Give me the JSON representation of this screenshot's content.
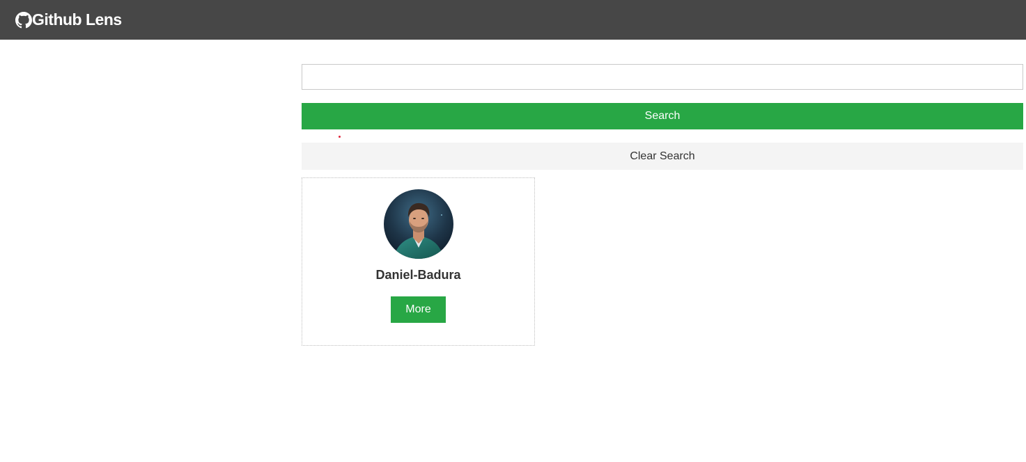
{
  "navbar": {
    "brand_icon": "github-icon",
    "brand_text": "Github Lens"
  },
  "search": {
    "value": "",
    "placeholder": "",
    "button_label": "Search",
    "clear_label": "Clear Search"
  },
  "users": [
    {
      "login": "Daniel-Badura",
      "avatar": "avatar-photo",
      "more_label": "More"
    }
  ],
  "colors": {
    "navbar_bg": "#474747",
    "primary": "#28a745",
    "light_button_bg": "#f4f4f4"
  }
}
